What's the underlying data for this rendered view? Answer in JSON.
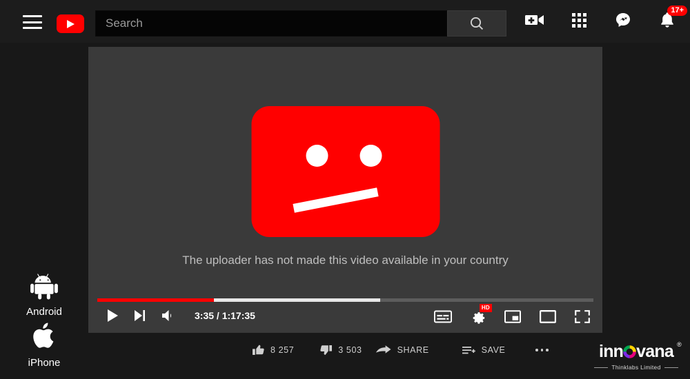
{
  "header": {
    "menu_label": "Menu",
    "logo_label": "YouTube",
    "search": {
      "value": "",
      "placeholder": "Search"
    },
    "search_button_label": "Search",
    "icons": [
      {
        "name": "create-video-icon",
        "label": "Create"
      },
      {
        "name": "apps-grid-icon",
        "label": "YouTube apps"
      },
      {
        "name": "messages-icon",
        "label": "Messages"
      },
      {
        "name": "notifications-bell-icon",
        "label": "Notifications",
        "badge": "17+"
      }
    ]
  },
  "sidebar": {
    "items": [
      {
        "icon": "android-icon",
        "label": "Android"
      },
      {
        "icon": "apple-icon",
        "label": "iPhone"
      }
    ]
  },
  "player": {
    "error_message": "The uploader has not made this video available in your country",
    "progress": {
      "played_percent": 23.5,
      "buffered_percent": 57
    },
    "time": "3:35 / 1:17:35",
    "current_time": "3:35",
    "duration": "1:17:35",
    "controls_left": [
      {
        "name": "play-button",
        "label": "Play"
      },
      {
        "name": "next-video-button",
        "label": "Next"
      },
      {
        "name": "mute-button",
        "label": "Mute"
      }
    ],
    "controls_right": [
      {
        "name": "subtitles-button",
        "label": "Subtitles/CC"
      },
      {
        "name": "settings-button",
        "label": "Settings",
        "badge": "HD"
      },
      {
        "name": "miniplayer-button",
        "label": "Miniplayer"
      },
      {
        "name": "theater-button",
        "label": "Theater mode"
      },
      {
        "name": "fullscreen-button",
        "label": "Full screen"
      }
    ]
  },
  "actions": {
    "like": {
      "icon": "thumbs-up-icon",
      "count": "8 257"
    },
    "dislike": {
      "icon": "thumbs-down-icon",
      "count": "3 503"
    },
    "share": {
      "icon": "share-arrow-icon",
      "label": "SHARE"
    },
    "save": {
      "icon": "save-playlist-icon",
      "label": "SAVE"
    },
    "more": {
      "icon": "more-horizontal-icon",
      "label": "More actions"
    }
  },
  "brand": {
    "name_before": "inn",
    "name_after": "vana",
    "registered": "®",
    "tagline": "Thinklabs Limited"
  },
  "colors": {
    "page_bg": "#181818",
    "header_bg": "#1c1c1c",
    "player_bg": "#3a3a3a",
    "accent_red": "#ff0000",
    "search_bg": "#050505",
    "search_button_bg": "#313131",
    "text_muted": "#bfbfbf"
  }
}
